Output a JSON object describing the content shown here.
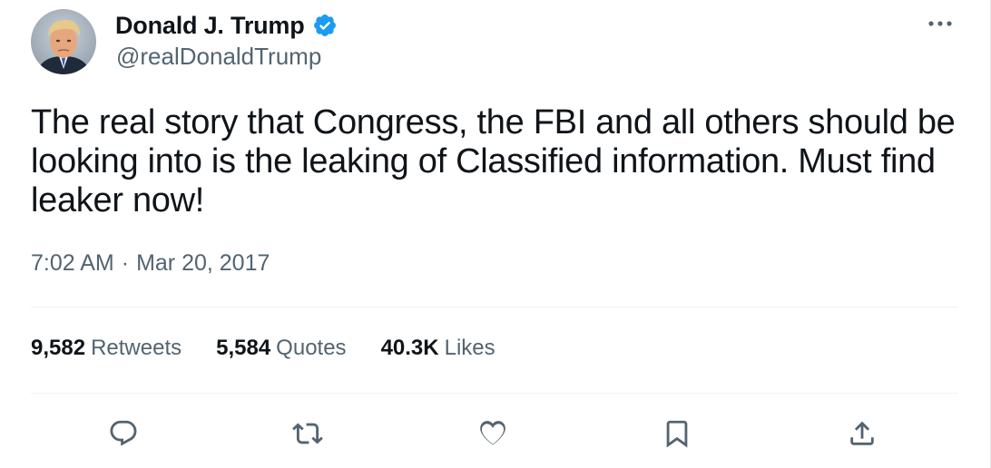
{
  "author": {
    "display_name": "Donald J. Trump",
    "handle": "@realDonaldTrump",
    "verified": true,
    "verified_color": "#1d9bf0"
  },
  "tweet": {
    "text": "The real story that Congress, the FBI and all others should be looking into is the leaking of Classified information. Must find leaker now!",
    "time": "7:02 AM",
    "separator": "·",
    "date": "Mar 20, 2017"
  },
  "stats": [
    {
      "count": "9,582",
      "label": "Retweets"
    },
    {
      "count": "5,584",
      "label": "Quotes"
    },
    {
      "count": "40.3K",
      "label": "Likes"
    }
  ],
  "actions": [
    {
      "icon": "reply-icon"
    },
    {
      "icon": "retweet-icon"
    },
    {
      "icon": "like-icon"
    },
    {
      "icon": "bookmark-icon"
    },
    {
      "icon": "share-icon"
    }
  ],
  "colors": {
    "text_primary": "#0f1419",
    "text_secondary": "#536471",
    "divider": "#eff3f4"
  }
}
